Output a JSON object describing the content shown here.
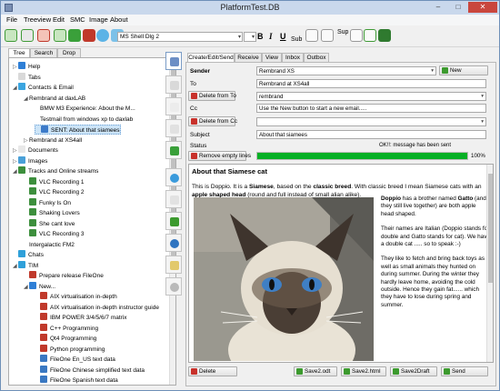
{
  "window": {
    "title": "PlatformTest.DB",
    "min": "–",
    "max": "□",
    "close": "✕"
  },
  "menu": [
    "File",
    "Treeview",
    "Edit",
    "SMC",
    "Image",
    "About"
  ],
  "toolbar": {
    "font_name": "MS Shell Dlg 2",
    "bold": "B",
    "italic": "I",
    "underline": "U",
    "sub": "Sub",
    "sup": "Sup",
    "combo_arrow": "▾"
  },
  "left_tabs": [
    "Tree",
    "Search",
    "Drop"
  ],
  "tree": [
    {
      "label": "Help",
      "icon_color": "#2f7fd6",
      "expander": "▷"
    },
    {
      "label": "Tabs",
      "icon_color": "#d9d9d9",
      "expander": ""
    },
    {
      "label": "Contacts & Email",
      "icon_color": "#3ba5e0",
      "expander": "◢"
    },
    {
      "label": "Rembrand at daxLAB",
      "icon_color": "",
      "expander": "◢"
    },
    {
      "label": "BMW M3 Experience: About the M...",
      "icon_color": "",
      "expander": ""
    },
    {
      "label": "Testmail from windows xp to daxlab",
      "icon_color": "",
      "expander": ""
    },
    {
      "label": "SENT: About that siamees",
      "icon_color": "#3c7ac9",
      "expander": ""
    },
    {
      "label": "Rembrand at XS4all",
      "icon_color": "",
      "expander": "▷"
    },
    {
      "label": "Documents",
      "icon_color": "#e8e8e8",
      "expander": "▷"
    },
    {
      "label": "Images",
      "icon_color": "#4aa0d8",
      "expander": "▷"
    },
    {
      "label": "Tracks and Online streams",
      "icon_color": "#3d8f3d",
      "expander": "◢"
    },
    {
      "label": "VLC Recording 1",
      "icon_color": "#3d8f3d",
      "expander": ""
    },
    {
      "label": "VLC Recording 2",
      "icon_color": "#3d8f3d",
      "expander": ""
    },
    {
      "label": "Funky Is On",
      "icon_color": "#3d8f3d",
      "expander": ""
    },
    {
      "label": "Shaking Lovers",
      "icon_color": "#3d8f3d",
      "expander": ""
    },
    {
      "label": "She cant love",
      "icon_color": "#3d8f3d",
      "expander": ""
    },
    {
      "label": "VLC Recording 3",
      "icon_color": "#3d8f3d",
      "expander": ""
    },
    {
      "label": "Intergalactic FM2",
      "icon_color": "",
      "expander": ""
    },
    {
      "label": "Chats",
      "icon_color": "#2fa0d9",
      "expander": ""
    },
    {
      "label": "TIM",
      "icon_color": "#2fa0d9",
      "expander": "◢"
    },
    {
      "label": "Prepare release FileOne",
      "icon_color": "#c0392b",
      "expander": ""
    },
    {
      "label": "New...",
      "icon_color": "#2f7fd6",
      "expander": "◢"
    },
    {
      "label": "AIX virtualisation in-depth",
      "icon_color": "#c0392b",
      "expander": ""
    },
    {
      "label": "AIX virtualisation in-depth instructor guide",
      "icon_color": "#c0392b",
      "expander": ""
    },
    {
      "label": "IBM POWER 3/4/5/6/7 matrix",
      "icon_color": "#c0392b",
      "expander": ""
    },
    {
      "label": "C++ Programming",
      "icon_color": "#c0392b",
      "expander": ""
    },
    {
      "label": "Qt4 Programming",
      "icon_color": "#c0392b",
      "expander": ""
    },
    {
      "label": "Python programming",
      "icon_color": "#c0392b",
      "expander": ""
    },
    {
      "label": "FileOne En_US text data",
      "icon_color": "#3a78c2",
      "expander": ""
    },
    {
      "label": "FileOne Chinese simplified text data",
      "icon_color": "#3a78c2",
      "expander": ""
    },
    {
      "label": "FileOne Spanish text data",
      "icon_color": "#3a78c2",
      "expander": ""
    }
  ],
  "right_tabs": [
    "Create/Edit/Send",
    "Receive",
    "View",
    "Inbox",
    "Outbox"
  ],
  "form": {
    "sender_label": "Sender",
    "sender_value": "Rembrand XS",
    "new_button": "New",
    "to_label": "To",
    "to_value": "Rembrand at XS4all",
    "delete_to_button": "Delete from To",
    "to_select_value": "rembrand",
    "cc_label": "Cc",
    "cc_value": "Use the New button to start a new email.....",
    "delete_cc_button": "Delete from Cc",
    "cc_select_value": "",
    "subject_label": "Subject",
    "subject_value": "About that siamees",
    "status_label": "Status",
    "status_message": "OK!!: message has been sent",
    "remove_empty_button": "Remove empty lines",
    "progress_percent": 100,
    "progress_text": "100%"
  },
  "body": {
    "heading": "About that Siamese cat",
    "intro_1": "This is Doppio. It is a ",
    "intro_siamese": "Siamese",
    "intro_2": ", based on the ",
    "intro_classic": "classic breed",
    "intro_3": ". With classic breed I mean Siamese cats with an ",
    "intro_apple": "apple shaped head",
    "intro_4": " (round and full instead of small alian alike).",
    "side_doppio": "Doppio",
    "side_p1a": " has a brother named ",
    "side_gatto": "Gatto",
    "side_p1b": " (and they still live together) are both apple head shaped.",
    "side_p2": "Their names are Italian (Doppio stands for double and Gatto stands for cat). We have a double cat ..... so to speak :-)",
    "side_p3": "They like to fetch and bring back toys as well as small animals they hunted on during summer. During the winter they hardly leave home, avoiding the cold outside. Hence they gain fat...... which they have to lose during spring and summer."
  },
  "bottom": {
    "delete_button": "Delete",
    "save_odt_button": "Save2.odt",
    "save_html_button": "Save2.html",
    "save_draft_button": "Save2Draft",
    "send_button": "Send"
  }
}
